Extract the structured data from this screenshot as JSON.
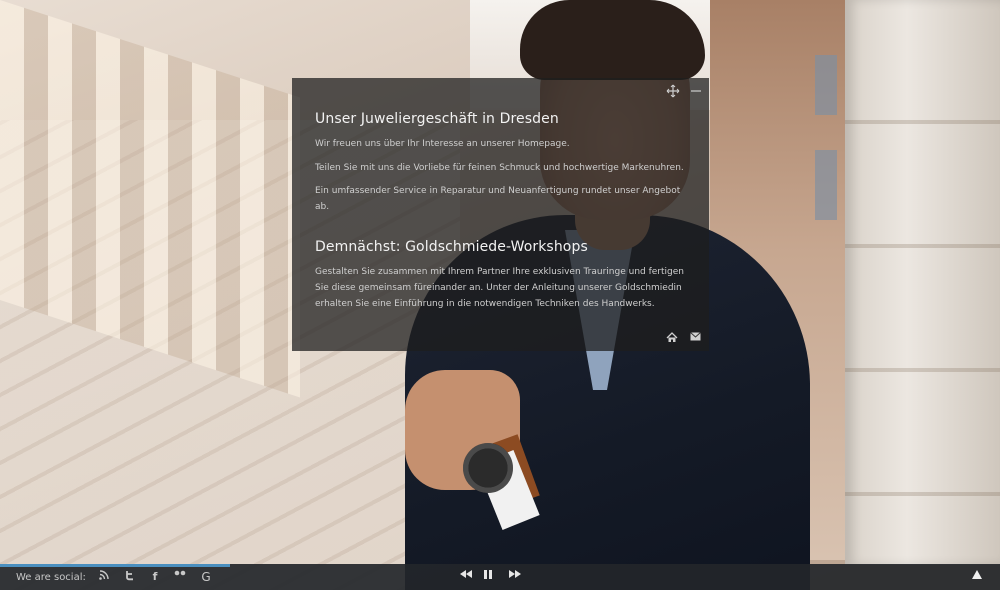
{
  "panel": {
    "heading1": "Unser Juweliergeschäft in Dresden",
    "para1": "Wir freuen uns über Ihr Interesse an unserer Homepage.",
    "para2": "Teilen Sie mit uns die Vorliebe für feinen Schmuck und hochwertige Markenuhren.",
    "para3": "Ein umfassender Service in Reparatur und Neuanfertigung rundet unser Angebot ab.",
    "heading2": "Demnächst: Goldschmiede-Workshops",
    "para4": "Gestalten Sie zusammen mit Ihrem Partner Ihre exklusiven Trauringe und fertigen Sie diese gemeinsam füreinander an. Unter der Anleitung unserer Goldschmiedin erhalten Sie eine Einführung in die notwendigen Techniken des Handwerks.",
    "controls": {
      "expand_icon": "expand-icon",
      "minimize_icon": "minimize-icon"
    },
    "footer_icons": [
      "home-icon",
      "mail-icon"
    ]
  },
  "bottombar": {
    "social_label": "We are social:",
    "social_icons": [
      "rss-icon",
      "twitter-icon",
      "facebook-icon",
      "flickr-icon",
      "google-icon"
    ],
    "player_icons": [
      "rewind-icon",
      "pause-icon",
      "forward-icon"
    ],
    "scroll_top_icon": "arrow-up-icon",
    "progress": 0.23,
    "progress_color": "#4a8fbf"
  }
}
